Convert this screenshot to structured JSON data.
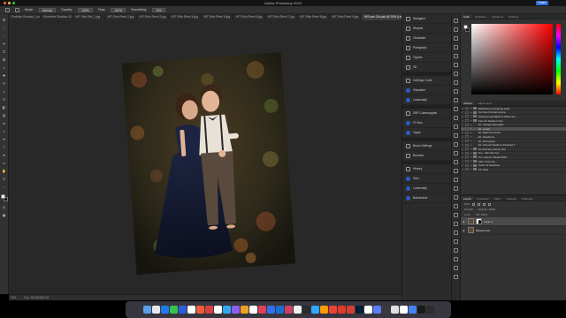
{
  "window": {
    "title": "Adobe Photoshop 2023",
    "share_label": "Share"
  },
  "options_bar": {
    "items": [
      "Mode:",
      "Normal",
      "Opacity:",
      "100%",
      "Flow:",
      "100%",
      "Smoothing:",
      "10%"
    ]
  },
  "tabs": [
    {
      "label": "Portfolio Shadow_1.psd",
      "active": false
    },
    {
      "label": "Shoreline Shadow 02.4",
      "active": false
    },
    {
      "label": "WT-Shin Ret_1.jpg",
      "active": false
    },
    {
      "label": "WT-Shin Reed 2.jpg",
      "active": false
    },
    {
      "label": "WT-Shin Reed 3.jpg",
      "active": false
    },
    {
      "label": "WT-Shin Reed 4.jpg",
      "active": false
    },
    {
      "label": "WT-Shin Reed 5.jpg",
      "active": false
    },
    {
      "label": "WT-Shin Reed 6.jpg",
      "active": false
    },
    {
      "label": "WT-Shin Reed 7.jpg",
      "active": false
    },
    {
      "label": "WT-Shin Reed 8.jpg",
      "active": false
    },
    {
      "label": "WT-Shin Reed 9.jpg",
      "active": false
    },
    {
      "label": "WS-san Cut.psd @ 25% (Layer 1, Layer Mask/8) *",
      "active": true
    }
  ],
  "panel_groups": [
    [
      "Navigator",
      "Shapes",
      "Character",
      "Paragraph",
      "Glyphs",
      "3D"
    ],
    [
      "InDesign Cube",
      "Visualizer",
      "Luminosity"
    ],
    [
      "SBP Cubemapped",
      "FX Box",
      "Topaz"
    ],
    [
      "Brush Settings",
      "Brushes"
    ],
    [
      "History",
      "Skin",
      "Luminosity",
      "Batchedlue"
    ]
  ],
  "color_panel": {
    "tabs": [
      "Color",
      "Swatches",
      "Gradients",
      "Patterns"
    ]
  },
  "actions_panel": {
    "tabs": [
      "Actions",
      "Adjustments"
    ],
    "rows": [
      {
        "name": "Blackhole for Drawing Light",
        "sub": false,
        "selected": false
      },
      {
        "name": "SL Pass Portrait Actions",
        "sub": false,
        "selected": false
      },
      {
        "name": "Drawing Light Black & White Set",
        "sub": false,
        "selected": false
      },
      {
        "name": "Fine Art Newborn Set",
        "sub": false,
        "selected": false
      },
      {
        "name": "Ex. Vintage Warmlight",
        "sub": true,
        "selected": false
      },
      {
        "name": "Ex. Lovely",
        "sub": true,
        "selected": true
      },
      {
        "name": "Ex. Matte Envelope",
        "sub": true,
        "selected": false
      },
      {
        "name": "Ex. Newborns",
        "sub": true,
        "selected": false
      },
      {
        "name": "Ex. Honeydew",
        "sub": true,
        "selected": false
      },
      {
        "name": "Ex. Fine Art Newborn Finished 2",
        "sub": true,
        "selected": false
      },
      {
        "name": "SL Painterly Actions Set",
        "sub": false,
        "selected": false
      },
      {
        "name": "Pro - Skin Ret Set",
        "sub": false,
        "selected": false
      },
      {
        "name": "Pro. Autumn Pastel 2020",
        "sub": false,
        "selected": false
      },
      {
        "name": "Kids Trunk Set",
        "sub": false,
        "selected": false
      },
      {
        "name": "Invert for Selection",
        "sub": false,
        "selected": false
      },
      {
        "name": "Fix Twist",
        "sub": false,
        "selected": false
      }
    ]
  },
  "layers_panel": {
    "tabs": [
      "Layers",
      "Properties",
      "Paths",
      "Libraries",
      "Channels"
    ],
    "filter_label": "Kind",
    "blend_mode": "Normal",
    "opacity_label": "Opacity: 100%",
    "fill_label": "Fill: 100%",
    "lock_label": "Lock:",
    "layers": [
      {
        "name": "Layer 1",
        "selected": true,
        "has_mask": true
      },
      {
        "name": "Background",
        "selected": false,
        "has_mask": false
      }
    ]
  },
  "status_bar": {
    "zoom": "25%",
    "doc_info": "Doc: 93.6M/186.7M"
  },
  "dock": {
    "colors": [
      "#5a9ee8",
      "#e8e8e8",
      "#1f7af0",
      "#37c24b",
      "#2a5de0",
      "#ffffff",
      "#f05d3b",
      "#d94040",
      "#ffffff",
      "#30a7f0",
      "#8c5ef0",
      "#f0a020",
      "#ffffff",
      "#e0405a",
      "#3070f0",
      "#1a6fd0",
      "#d04060",
      "#f0f0f0",
      "#2a2a2a",
      "#31a8ff",
      "#ff9a00",
      "#ea4335",
      "#e03a2a",
      "#d44030",
      "#001e36",
      "#ffffff",
      "#5c7cfa",
      "#3a3a3a",
      "#e0e0e0",
      "#ffffff",
      "#4285f4",
      "#1a1a1a",
      "#2c2c2c"
    ]
  }
}
